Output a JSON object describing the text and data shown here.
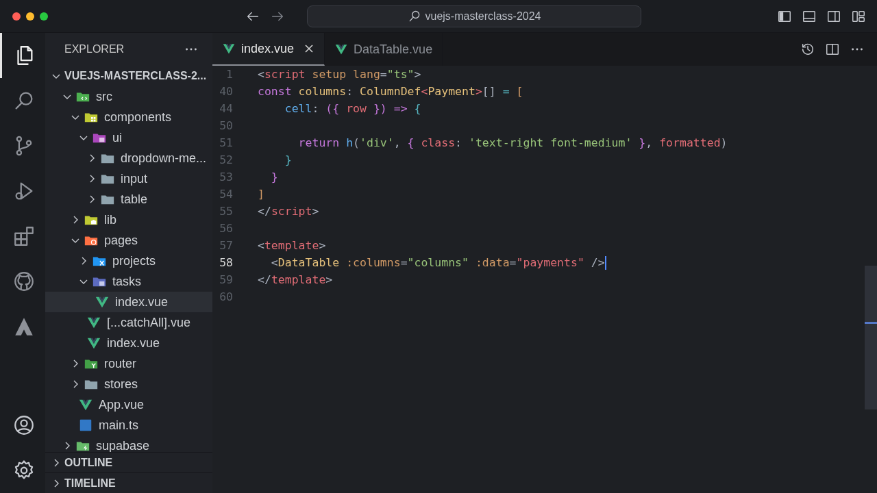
{
  "window": {
    "title": "vuejs-masterclass-2024"
  },
  "activity_bar": [
    {
      "kind": "files",
      "selected": true
    },
    {
      "kind": "search",
      "selected": false
    },
    {
      "kind": "git",
      "selected": false
    },
    {
      "kind": "debug",
      "selected": false
    },
    {
      "kind": "extensions",
      "selected": false
    },
    {
      "kind": "github",
      "selected": false
    },
    {
      "kind": "triangle",
      "selected": false
    }
  ],
  "activity_bottom": [
    {
      "kind": "account"
    },
    {
      "kind": "settings"
    }
  ],
  "sidebar": {
    "title": "EXPLORER",
    "root": {
      "label": "VUEJS-MASTERCLASS-2...",
      "expanded": true
    },
    "tree": [
      {
        "label": "src",
        "kind": "srcfolder",
        "expanded": true,
        "selected": false,
        "children": [
          {
            "label": "components",
            "kind": "componentsfolder",
            "expanded": true,
            "selected": false,
            "children": [
              {
                "label": "ui",
                "kind": "uifolder",
                "expanded": true,
                "selected": false,
                "children": [
                  {
                    "label": "dropdown-me...",
                    "kind": "folder",
                    "expanded": false,
                    "selected": false
                  },
                  {
                    "label": "input",
                    "kind": "folder",
                    "expanded": false,
                    "selected": false
                  },
                  {
                    "label": "table",
                    "kind": "folder",
                    "expanded": false,
                    "selected": false
                  }
                ]
              }
            ]
          },
          {
            "label": "lib",
            "kind": "libfolder",
            "expanded": false,
            "selected": false
          },
          {
            "label": "pages",
            "kind": "pagesfolder",
            "expanded": true,
            "selected": false,
            "children": [
              {
                "label": "projects",
                "kind": "projectsfolder",
                "expanded": false,
                "selected": false
              },
              {
                "label": "tasks",
                "kind": "tasksfolder",
                "expanded": true,
                "selected": false,
                "children": [
                  {
                    "label": "index.vue",
                    "kind": "vuefile",
                    "selected": true
                  }
                ]
              },
              {
                "label": "[...catchAll].vue",
                "kind": "vuefile",
                "selected": false
              },
              {
                "label": "index.vue",
                "kind": "vuefile",
                "selected": false
              }
            ]
          },
          {
            "label": "router",
            "kind": "routerfolder",
            "expanded": false,
            "selected": false
          },
          {
            "label": "stores",
            "kind": "folder",
            "expanded": false,
            "selected": false
          },
          {
            "label": "App.vue",
            "kind": "vuefile",
            "selected": false
          },
          {
            "label": "main.ts",
            "kind": "tsfile",
            "selected": false
          }
        ]
      },
      {
        "label": "supabase",
        "kind": "supabasefolder",
        "expanded": false,
        "selected": false
      }
    ],
    "sections": [
      {
        "label": "OUTLINE",
        "expanded": false
      },
      {
        "label": "TIMELINE",
        "expanded": false
      }
    ]
  },
  "tabs": [
    {
      "label": "index.vue",
      "selected": true
    },
    {
      "label": "DataTable.vue",
      "selected": false
    }
  ],
  "editor": {
    "lines": [
      {
        "number": "1",
        "current": false,
        "tokens": [
          {
            "text": "<",
            "kind": "p"
          },
          {
            "text": "script",
            "kind": "tag"
          },
          {
            "text": " setup",
            "kind": "attr"
          },
          {
            "text": " lang",
            "kind": "attr"
          },
          {
            "text": "=",
            "kind": "p"
          },
          {
            "text": "\"ts\"",
            "kind": "str"
          },
          {
            "text": ">",
            "kind": "p"
          }
        ]
      },
      {
        "number": "40",
        "current": false,
        "tokens": [
          {
            "text": "const ",
            "kind": "kw"
          },
          {
            "text": "columns",
            "kind": "var"
          },
          {
            "text": ": ",
            "kind": "p"
          },
          {
            "text": "ColumnDef",
            "kind": "var"
          },
          {
            "text": "<",
            "kind": "tag"
          },
          {
            "text": "Payment",
            "kind": "var"
          },
          {
            "text": ">",
            "kind": "tag"
          },
          {
            "text": "[]",
            "kind": "p"
          },
          {
            "text": " = ",
            "kind": "op"
          },
          {
            "text": "[",
            "kind": "br1"
          }
        ]
      },
      {
        "number": "44",
        "current": false,
        "tokens": [
          {
            "text": "    cell",
            "kind": "fn"
          },
          {
            "text": ": ",
            "kind": "p"
          },
          {
            "text": "({",
            "kind": "br2"
          },
          {
            "text": " row ",
            "kind": "param"
          },
          {
            "text": "})",
            "kind": "br2"
          },
          {
            "text": " => ",
            "kind": "kw"
          },
          {
            "text": "{",
            "kind": "br3"
          }
        ]
      },
      {
        "number": "50",
        "current": false
      },
      {
        "number": "51",
        "current": false,
        "tokens": [
          {
            "text": "      return ",
            "kind": "kw"
          },
          {
            "text": "h",
            "kind": "fn"
          },
          {
            "text": "(",
            "kind": "p"
          },
          {
            "text": "'div'",
            "kind": "str"
          },
          {
            "text": ", ",
            "kind": "p"
          },
          {
            "text": "{ ",
            "kind": "br2"
          },
          {
            "text": "class",
            "kind": "param"
          },
          {
            "text": ": ",
            "kind": "p"
          },
          {
            "text": "'text-right font-medium'",
            "kind": "str"
          },
          {
            "text": " }",
            "kind": "br2"
          },
          {
            "text": ", ",
            "kind": "p"
          },
          {
            "text": "formatted",
            "kind": "param"
          },
          {
            "text": ")",
            "kind": "p"
          }
        ]
      },
      {
        "number": "52",
        "current": false,
        "tokens": [
          {
            "text": "    }",
            "kind": "br3"
          }
        ]
      },
      {
        "number": "53",
        "current": false,
        "tokens": [
          {
            "text": "  }",
            "kind": "br2"
          }
        ]
      },
      {
        "number": "54",
        "current": false,
        "tokens": [
          {
            "text": "]",
            "kind": "br1"
          }
        ]
      },
      {
        "number": "55",
        "current": false,
        "tokens": [
          {
            "text": "</",
            "kind": "p"
          },
          {
            "text": "script",
            "kind": "tag"
          },
          {
            "text": ">",
            "kind": "p"
          }
        ]
      },
      {
        "number": "56",
        "current": false
      },
      {
        "number": "57",
        "current": false,
        "tokens": [
          {
            "text": "<",
            "kind": "p"
          },
          {
            "text": "template",
            "kind": "tag"
          },
          {
            "text": ">",
            "kind": "p"
          }
        ]
      },
      {
        "number": "58",
        "current": true,
        "tokens": [
          {
            "text": "  <",
            "kind": "p"
          },
          {
            "text": "DataTable",
            "kind": "var"
          },
          {
            "text": " :columns",
            "kind": "attr"
          },
          {
            "text": "=",
            "kind": "p"
          },
          {
            "text": "\"columns\"",
            "kind": "str"
          },
          {
            "text": " :data",
            "kind": "attr"
          },
          {
            "text": "=",
            "kind": "p"
          },
          {
            "text": "\"payments\"",
            "kind": "tag"
          },
          {
            "text": " />",
            "kind": "p"
          }
        ]
      },
      {
        "number": "59",
        "current": false,
        "tokens": [
          {
            "text": "</",
            "kind": "p"
          },
          {
            "text": "template",
            "kind": "tag"
          },
          {
            "text": ">",
            "kind": "p"
          }
        ]
      },
      {
        "number": "60",
        "current": false
      }
    ]
  }
}
